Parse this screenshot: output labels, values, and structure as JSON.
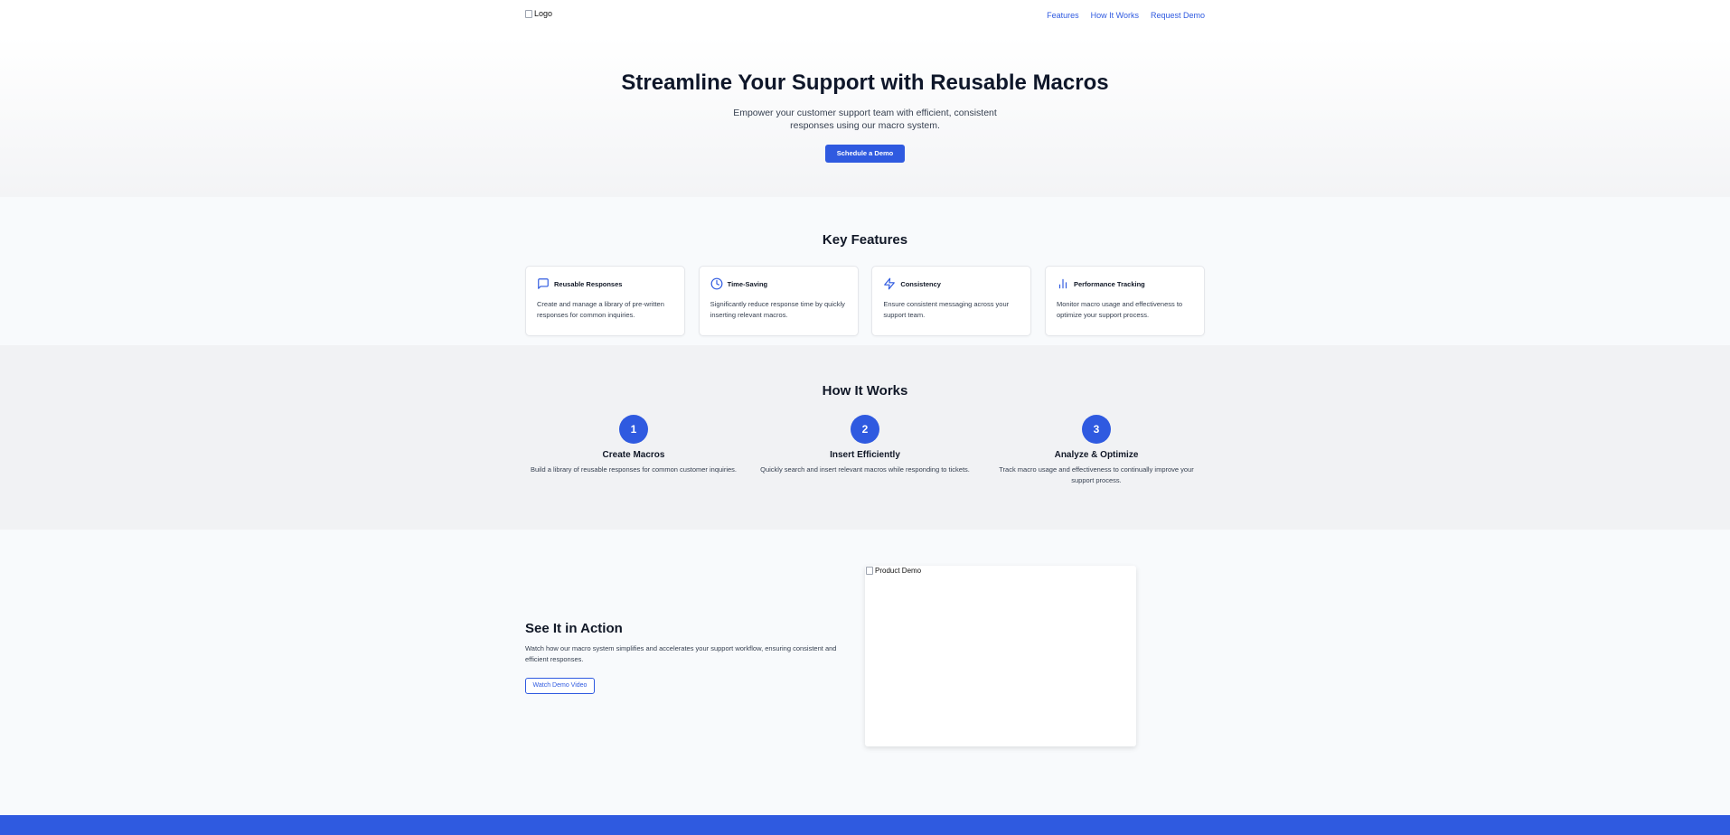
{
  "header": {
    "logo_alt": "Logo",
    "nav": [
      {
        "label": "Features"
      },
      {
        "label": "How It Works"
      },
      {
        "label": "Request Demo"
      }
    ]
  },
  "hero": {
    "title": "Streamline Your Support with Reusable Macros",
    "subtitle": "Empower your customer support team with efficient, consistent responses using our macro system.",
    "cta_label": "Schedule a Demo"
  },
  "features": {
    "title": "Key Features",
    "items": [
      {
        "icon": "message-square-icon",
        "title": "Reusable Responses",
        "desc": "Create and manage a library of pre-written responses for common inquiries."
      },
      {
        "icon": "clock-icon",
        "title": "Time-Saving",
        "desc": "Significantly reduce response time by quickly inserting relevant macros."
      },
      {
        "icon": "zap-icon",
        "title": "Consistency",
        "desc": "Ensure consistent messaging across your support team."
      },
      {
        "icon": "bar-chart-icon",
        "title": "Performance Tracking",
        "desc": "Monitor macro usage and effectiveness to optimize your support process."
      }
    ]
  },
  "how": {
    "title": "How It Works",
    "steps": [
      {
        "num": "1",
        "title": "Create Macros",
        "desc": "Build a library of reusable responses for common customer inquiries."
      },
      {
        "num": "2",
        "title": "Insert Efficiently",
        "desc": "Quickly search and insert relevant macros while responding to tickets."
      },
      {
        "num": "3",
        "title": "Analyze & Optimize",
        "desc": "Track macro usage and effectiveness to continually improve your support process."
      }
    ]
  },
  "demo": {
    "title": "See It in Action",
    "desc": "Watch how our macro system simplifies and accelerates your support workflow, ensuring consistent and efficient responses.",
    "button_label": "Watch Demo Video",
    "image_alt": "Product Demo"
  },
  "colors": {
    "accent": "#2f5ae0",
    "text": "#111827",
    "muted": "#374151"
  }
}
